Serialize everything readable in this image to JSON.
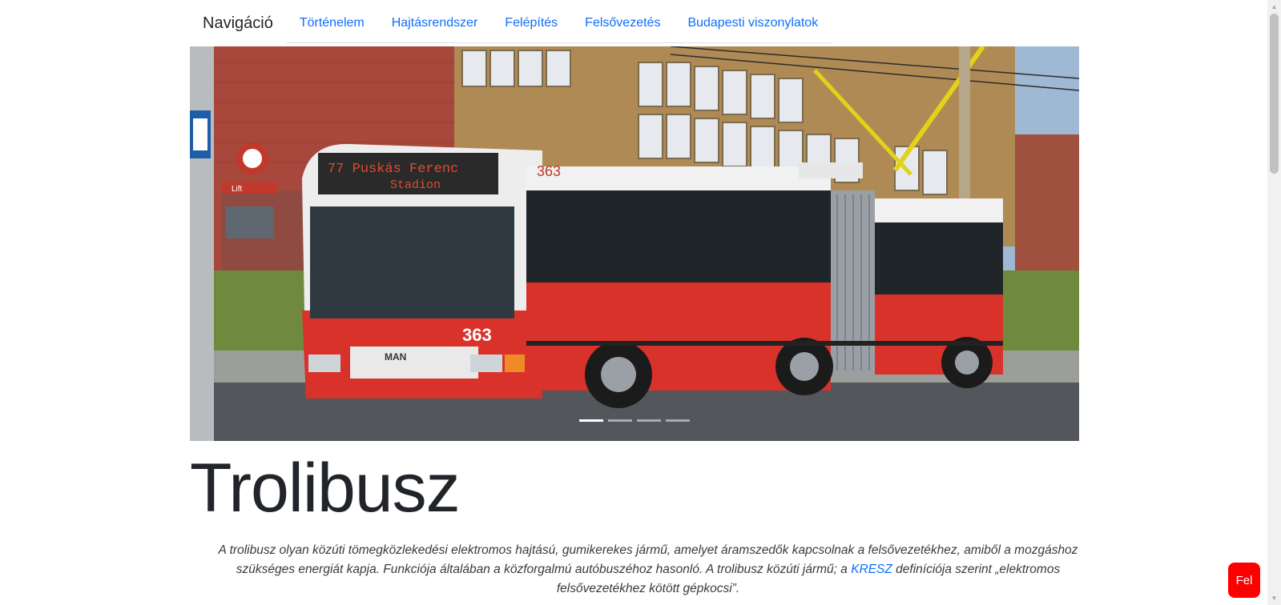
{
  "nav": {
    "brand": "Navigáció",
    "tabs": [
      {
        "label": "Történelem"
      },
      {
        "label": "Hajtásrendszer"
      },
      {
        "label": "Felépítés"
      },
      {
        "label": "Felsővezetés"
      },
      {
        "label": "Budapesti viszonylatok"
      }
    ]
  },
  "carousel": {
    "active_index": 1,
    "slide_count": 4,
    "bus": {
      "destination_line1": "77 Puskás Ferenc",
      "destination_line2": "Stadion",
      "fleet_number": "363",
      "brand": "MAN",
      "lift_sign": "Lift"
    }
  },
  "main": {
    "title": "Trolibusz",
    "intro_before_link": "A trolibusz olyan közúti tömegközlekedési elektromos hajtású, gumikerekes jármű, amelyet áramszedők kapcsolnak a felsővezetékhez, amiből a mozgáshoz szükséges energiát kapja. Funkciója általában a közforgalmú autóbuszéhoz hasonló. A trolibusz közúti jármű; a ",
    "intro_link": "KRESZ",
    "intro_after_link": " definíciója szerint „elektromos felsővezetékhez kötött gépkocsi”."
  },
  "fel_button": {
    "label": "Fel",
    "color": "#ff0000"
  },
  "colors": {
    "link": "#0d6efd",
    "bus_red": "#d9322b"
  }
}
